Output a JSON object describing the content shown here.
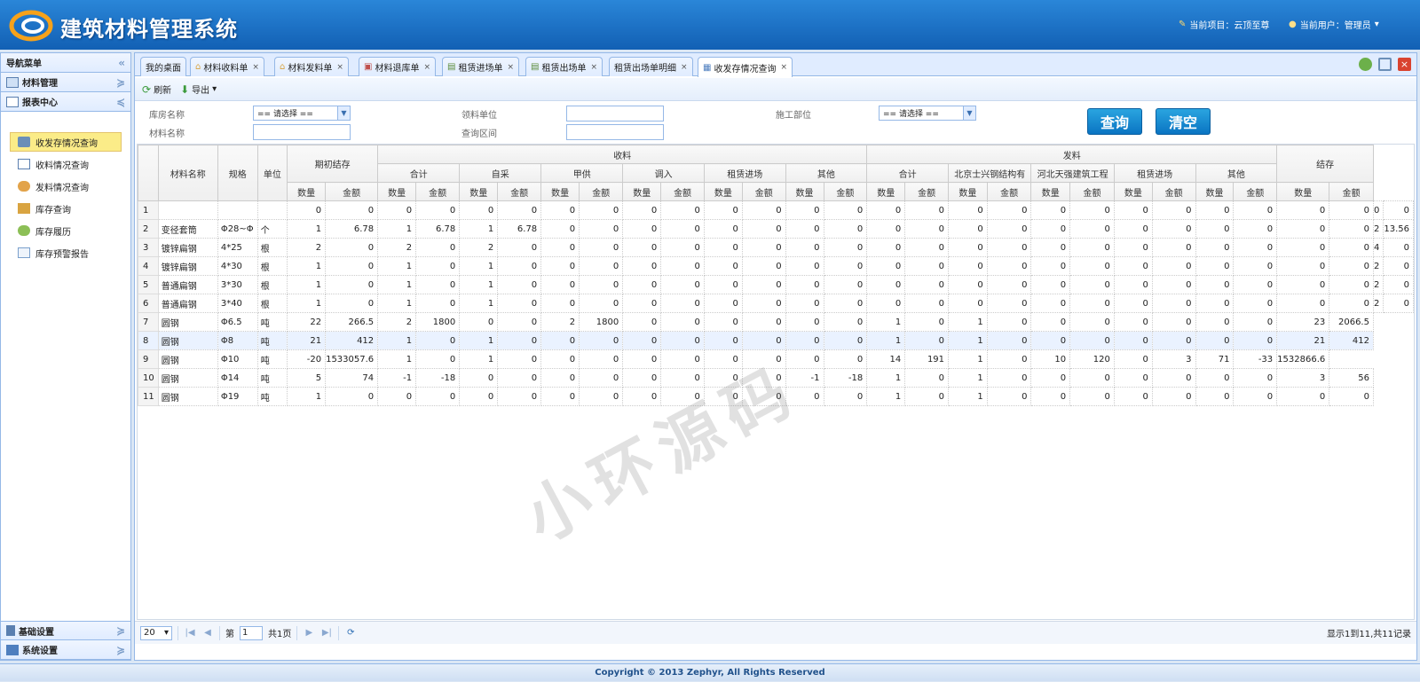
{
  "app": {
    "title": "建筑材料管理系统",
    "project_label": "当前项目：云顶至尊",
    "user_label": "当前用户：管理员"
  },
  "sidebar": {
    "title": "导航菜单",
    "groups": [
      {
        "label": "材料管理"
      },
      {
        "label": "报表中心"
      },
      {
        "label": "基础设置"
      },
      {
        "label": "系统设置"
      }
    ],
    "items": [
      {
        "label": "收发存情况查询"
      },
      {
        "label": "收料情况查询"
      },
      {
        "label": "发料情况查询"
      },
      {
        "label": "库存查询"
      },
      {
        "label": "库存履历"
      },
      {
        "label": "库存预警报告"
      }
    ]
  },
  "tabs": [
    {
      "label": "我的桌面"
    },
    {
      "label": "材料收料单"
    },
    {
      "label": "材料发料单"
    },
    {
      "label": "材料退库单"
    },
    {
      "label": "租赁进场单"
    },
    {
      "label": "租赁出场单"
    },
    {
      "label": "租赁出场单明细"
    },
    {
      "label": "收发存情况查询"
    }
  ],
  "toolbar": {
    "refresh": "刷新",
    "export": "导出"
  },
  "filters": {
    "warehouse_label": "库房名称",
    "warehouse_value": "== 请选择 ==",
    "material_label": "材料名称",
    "receiver_label": "领料单位",
    "range_label": "查询区间",
    "dept_label": "施工部位",
    "dept_value": "== 请选择 ==",
    "query_btn": "查询",
    "clear_btn": "清空"
  },
  "table": {
    "h_name": "材料名称",
    "h_spec": "规格",
    "h_unit": "单位",
    "h_open": "期初结存",
    "h_recv": "收料",
    "h_issue": "发料",
    "h_bal": "结存",
    "h_total": "合计",
    "h_self": "自采",
    "h_supply": "甲供",
    "h_in": "调入",
    "h_rent_in": "租赁进场",
    "h_other": "其他",
    "h_issue_total": "合计",
    "h_bj": "北京士兴钢结构有",
    "h_hb": "河北天强建筑工程",
    "h_rent_out": "租赁进场",
    "h_issue_other": "其他",
    "qty": "数量",
    "amt": "金额",
    "rows": [
      [
        "1",
        "",
        "",
        "",
        "0",
        "0",
        "0",
        "0",
        "0",
        "0",
        "0",
        "0",
        "0",
        "0",
        "0",
        "0",
        "0",
        "0",
        "0",
        "0",
        "0",
        "0",
        "0",
        "0",
        "0",
        "0",
        "0",
        "0",
        "0",
        "0",
        "0",
        "0"
      ],
      [
        "2",
        "变径套筒",
        "Φ28~Φ",
        "个",
        "1",
        "6.78",
        "1",
        "6.78",
        "1",
        "6.78",
        "0",
        "0",
        "0",
        "0",
        "0",
        "0",
        "0",
        "0",
        "0",
        "0",
        "0",
        "0",
        "0",
        "0",
        "0",
        "0",
        "0",
        "0",
        "0",
        "0",
        "2",
        "13.56"
      ],
      [
        "3",
        "镀锌扁钢",
        "4*25",
        "根",
        "2",
        "0",
        "2",
        "0",
        "2",
        "0",
        "0",
        "0",
        "0",
        "0",
        "0",
        "0",
        "0",
        "0",
        "0",
        "0",
        "0",
        "0",
        "0",
        "0",
        "0",
        "0",
        "0",
        "0",
        "0",
        "0",
        "4",
        "0"
      ],
      [
        "4",
        "镀锌扁钢",
        "4*30",
        "根",
        "1",
        "0",
        "1",
        "0",
        "1",
        "0",
        "0",
        "0",
        "0",
        "0",
        "0",
        "0",
        "0",
        "0",
        "0",
        "0",
        "0",
        "0",
        "0",
        "0",
        "0",
        "0",
        "0",
        "0",
        "0",
        "0",
        "2",
        "0"
      ],
      [
        "5",
        "普通扁钢",
        "3*30",
        "根",
        "1",
        "0",
        "1",
        "0",
        "1",
        "0",
        "0",
        "0",
        "0",
        "0",
        "0",
        "0",
        "0",
        "0",
        "0",
        "0",
        "0",
        "0",
        "0",
        "0",
        "0",
        "0",
        "0",
        "0",
        "0",
        "0",
        "2",
        "0"
      ],
      [
        "6",
        "普通扁钢",
        "3*40",
        "根",
        "1",
        "0",
        "1",
        "0",
        "1",
        "0",
        "0",
        "0",
        "0",
        "0",
        "0",
        "0",
        "0",
        "0",
        "0",
        "0",
        "0",
        "0",
        "0",
        "0",
        "0",
        "0",
        "0",
        "0",
        "0",
        "0",
        "2",
        "0"
      ],
      [
        "7",
        "圆钢",
        "Φ6.5",
        "吨",
        "22",
        "266.5",
        "2",
        "1800",
        "0",
        "0",
        "2",
        "1800",
        "0",
        "0",
        "0",
        "0",
        "0",
        "0",
        "1",
        "0",
        "1",
        "0",
        "0",
        "0",
        "0",
        "0",
        "0",
        "0",
        "23",
        "2066.5"
      ],
      [
        "8",
        "圆钢",
        "Φ8",
        "吨",
        "21",
        "412",
        "1",
        "0",
        "1",
        "0",
        "0",
        "0",
        "0",
        "0",
        "0",
        "0",
        "0",
        "0",
        "1",
        "0",
        "1",
        "0",
        "0",
        "0",
        "0",
        "0",
        "0",
        "0",
        "21",
        "412"
      ],
      [
        "9",
        "圆钢",
        "Φ10",
        "吨",
        "-20",
        "1533057.6",
        "1",
        "0",
        "1",
        "0",
        "0",
        "0",
        "0",
        "0",
        "0",
        "0",
        "0",
        "0",
        "14",
        "191",
        "1",
        "0",
        "10",
        "120",
        "0",
        "3",
        "71",
        "-33",
        "1532866.6"
      ],
      [
        "10",
        "圆钢",
        "Φ14",
        "吨",
        "5",
        "74",
        "-1",
        "-18",
        "0",
        "0",
        "0",
        "0",
        "0",
        "0",
        "0",
        "0",
        "-1",
        "-18",
        "1",
        "0",
        "1",
        "0",
        "0",
        "0",
        "0",
        "0",
        "0",
        "0",
        "3",
        "56"
      ],
      [
        "11",
        "圆钢",
        "Φ19",
        "吨",
        "1",
        "0",
        "0",
        "0",
        "0",
        "0",
        "0",
        "0",
        "0",
        "0",
        "0",
        "0",
        "0",
        "0",
        "1",
        "0",
        "1",
        "0",
        "0",
        "0",
        "0",
        "0",
        "0",
        "0",
        "0",
        "0"
      ]
    ]
  },
  "pager": {
    "page_size": "20",
    "page_prefix": "第",
    "page_value": "1",
    "page_suffix": "共1页",
    "info": "显示1到11,共11记录"
  },
  "watermark": "小环源码",
  "footer": "Copyright © 2013 Zephyr, All Rights Reserved"
}
